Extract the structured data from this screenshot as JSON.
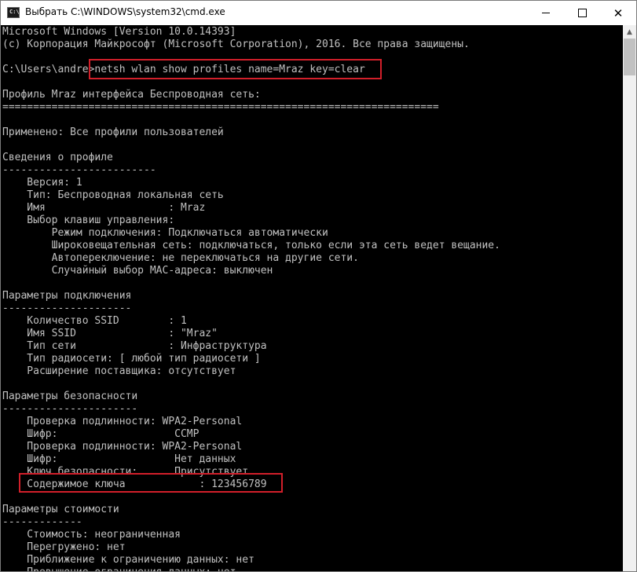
{
  "window": {
    "title": "Выбрать C:\\WINDOWS\\system32\\cmd.exe",
    "icon_label": "C:\\"
  },
  "controls": {
    "minimize": "minimize-icon",
    "maximize": "maximize-icon",
    "close": "close-icon",
    "close_glyph": "✕"
  },
  "scrollbar": {
    "up_glyph": "▲",
    "position_fraction": 0.0
  },
  "colors": {
    "console_bg": "#000000",
    "console_text": "#c0c0c0",
    "highlight": "#d21f2a"
  },
  "console": {
    "lines": [
      "Microsoft Windows [Version 10.0.14393]",
      "(c) Корпорация Майкрософт (Microsoft Corporation), 2016. Все права защищены.",
      "",
      "C:\\Users\\andre>netsh wlan show profiles name=Mraz key=clear",
      "",
      "Профиль Mraz интерфейса Беспроводная сеть:",
      "=======================================================================",
      "",
      "Применено: Все профили пользователей",
      "",
      "Сведения о профиле",
      "-------------------------",
      "    Версия: 1",
      "    Тип: Беспроводная локальная сеть",
      "    Имя                    : Mraz",
      "    Выбор клавиш управления:",
      "        Режим подключения: Подключаться автоматически",
      "        Широковещательная сеть: подключаться, только если эта сеть ведет вещание.",
      "        Автопереключение: не переключаться на другие сети.",
      "        Случайный выбор MAC-адреса: выключен",
      "",
      "Параметры подключения",
      "---------------------",
      "    Количество SSID        : 1",
      "    Имя SSID               : \"Mraz\"",
      "    Тип сети               : Инфраструктура",
      "    Тип радиосети: [ любой тип радиосети ]",
      "    Расширение поставщика: отсутствует",
      "",
      "Параметры безопасности",
      "----------------------",
      "    Проверка подлинности: WPA2-Personal",
      "    Шифр:                   CCMP",
      "    Проверка подлинности: WPA2-Personal",
      "    Шифр:                   Нет данных",
      "    Ключ безопасности:      Присутствует",
      "    Содержимое ключа            : 123456789",
      "",
      "Параметры стоимости",
      "-------------",
      "    Стоимость: неограниченная",
      "    Перегружено: нет",
      "    Приближение к ограничению данных: нет",
      "    Превышение ограничения данных: нет"
    ]
  }
}
